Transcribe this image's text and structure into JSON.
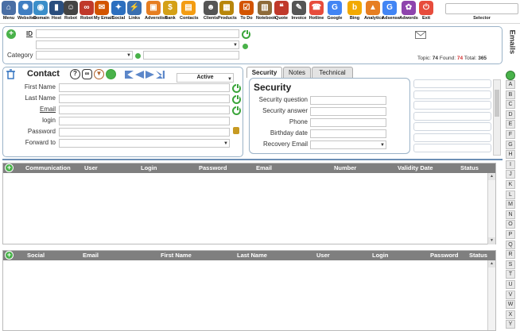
{
  "toolbar": {
    "items": [
      {
        "label": "Menu",
        "icon": "home-icon",
        "color": "#4a6fa5",
        "glyph": "⌂"
      },
      {
        "label": "Websites",
        "icon": "websites-icon",
        "color": "#3f7ec2",
        "glyph": "✺"
      },
      {
        "label": "Domain",
        "icon": "domain-icon",
        "color": "#3b8ec9",
        "glyph": "◉"
      },
      {
        "label": "Host",
        "icon": "host-icon",
        "color": "#2a4e7e",
        "glyph": "▮"
      },
      {
        "label": "Robot",
        "icon": "robot-icon",
        "color": "#444444",
        "glyph": "☺"
      },
      {
        "label": "Robot",
        "icon": "glasses-icon",
        "color": "#c0392b",
        "glyph": "∞"
      },
      {
        "label": "My Email",
        "icon": "email-icon",
        "color": "#d35400",
        "glyph": "✉"
      },
      {
        "label": "Social",
        "icon": "social-icon",
        "color": "#2c6fbf",
        "glyph": "✦"
      },
      {
        "label": "Links",
        "icon": "links-icon",
        "color": "#3a6fb0",
        "glyph": "⚡"
      },
      {
        "label": "Adverstise",
        "icon": "advertise-icon",
        "color": "#e67e22",
        "glyph": "▣"
      },
      {
        "label": "Bank",
        "icon": "bank-icon",
        "color": "#d4a017",
        "glyph": "$"
      },
      {
        "label": "Contacts",
        "icon": "contacts-icon",
        "color": "#f39c12",
        "glyph": "▤"
      },
      {
        "label": "Clients",
        "icon": "clients-icon",
        "color": "#555555",
        "glyph": "☻"
      },
      {
        "label": "Products",
        "icon": "products-icon",
        "color": "#b8860b",
        "glyph": "▦"
      },
      {
        "label": "To Do",
        "icon": "todo-icon",
        "color": "#d35400",
        "glyph": "☑"
      },
      {
        "label": "Notebook",
        "icon": "notebook-icon",
        "color": "#8e6b3a",
        "glyph": "▥"
      },
      {
        "label": "Quote",
        "icon": "quote-icon",
        "color": "#c0392b",
        "glyph": "❝"
      },
      {
        "label": "Invoice",
        "icon": "invoice-icon",
        "color": "#555555",
        "glyph": "✎"
      },
      {
        "label": "Hotline",
        "icon": "hotline-icon",
        "color": "#e74c3c",
        "glyph": "☎"
      },
      {
        "label": "Google",
        "icon": "google-icon",
        "color": "#4285f4",
        "glyph": "G"
      },
      {
        "label": "Bing",
        "icon": "bing-icon",
        "color": "#f2a900",
        "glyph": "b"
      },
      {
        "label": "Analytics",
        "icon": "analytics-icon",
        "color": "#e67e22",
        "glyph": "▲"
      },
      {
        "label": "Adsense",
        "icon": "adsense-icon",
        "color": "#4285f4",
        "glyph": "G"
      },
      {
        "label": "Adwords",
        "icon": "adwords-icon",
        "color": "#8e44ad",
        "glyph": "✿"
      },
      {
        "label": "Exit",
        "icon": "exit-icon",
        "color": "#e74c3c",
        "glyph": "⏻"
      }
    ],
    "selector_label": "Selector"
  },
  "search": {
    "id_label": "ID",
    "category_label": "Category",
    "stats": {
      "topic_label": "Topic:",
      "topic": "74",
      "found_label": "Found:",
      "found": "74",
      "total_label": "Total:",
      "total": "365"
    },
    "found_color": "#d32f2f"
  },
  "contact": {
    "title": "Contact",
    "status": "Active",
    "fields": [
      {
        "label": "First Name"
      },
      {
        "label": "Last Name"
      },
      {
        "label": "Email"
      },
      {
        "label": "login"
      },
      {
        "label": "Password"
      },
      {
        "label": "Forward to"
      }
    ]
  },
  "tabs": [
    {
      "label": "Security",
      "active": true
    },
    {
      "label": "Notes",
      "active": false
    },
    {
      "label": "Technical",
      "active": false
    }
  ],
  "security": {
    "title": "Security",
    "fields": [
      {
        "label": "Security question"
      },
      {
        "label": "Security answer"
      },
      {
        "label": "Phone"
      },
      {
        "label": "Birthday date"
      },
      {
        "label": "Recovery Email"
      }
    ]
  },
  "right_strip": {
    "title": "Emails",
    "letters": [
      "A",
      "B",
      "C",
      "D",
      "E",
      "F",
      "G",
      "H",
      "I",
      "J",
      "K",
      "L",
      "M",
      "N",
      "O",
      "P",
      "Q",
      "R",
      "S",
      "T",
      "U",
      "V",
      "W",
      "X",
      "Y"
    ]
  },
  "communication_grid": {
    "columns": [
      "Communication",
      "User",
      "Login",
      "Password",
      "Email",
      "Number",
      "Validity Date",
      "Status"
    ]
  },
  "social_grid": {
    "columns": [
      "Social",
      "Email",
      "First Name",
      "Last Name",
      "User",
      "Login",
      "Password",
      "Status"
    ]
  },
  "colors": {
    "accent": "#49b24a",
    "panel_border": "#9bb3c8",
    "grid_header": "#7f7f7f"
  }
}
